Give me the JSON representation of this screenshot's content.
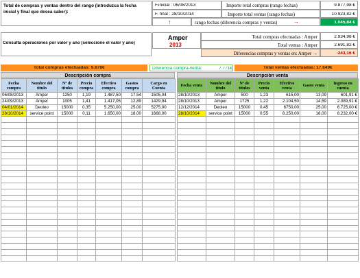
{
  "top": {
    "intro_text": "Total de compras y ventas dentro del rango (introduzca la fecha inicial y final que desea saber):",
    "f_inicial_label": "F.inicial : 06/08/2013",
    "f_final_label": "F. final : 28/10/2014",
    "import_compras_label": "Importe total compras  (rango fechas)",
    "import_compras_value": "9.877,98 €",
    "import_ventas_label": "Importe total ventas (rango fechas)",
    "import_ventas_value": "10.923,82 €",
    "rango_label": "rango fechas (diferencia compras y ventas)",
    "rango_arrow_up": "↑",
    "rango_arrow_right": "→",
    "rango_value": "1.045,84 €"
  },
  "consulta": {
    "label": "Consulta operaciones por valor y año (seleccione el valor y año)",
    "value_name": "Amper",
    "year": "2013",
    "total_compras_label": "Total compras efectuadas : Amper",
    "total_compras_value": "2.934,98 €",
    "total_ventas_label": "Total ventas : Amper",
    "total_ventas_value": "2.691,82 €",
    "diferencias_label": "Diferencias compras y ventas en:  Amper  →",
    "diferencias_value": "-243,16 €"
  },
  "summary": {
    "total_compras": "Total compras efectuadas: 9.878€",
    "diferencia": "Diferencia compra-venta:",
    "diferencia_value": "7.771€",
    "total_ventas": "Total ventas efectuadas: 17.649€"
  },
  "compra": {
    "title": "Descripción compra",
    "headers": [
      "Fecha compra",
      "Nombre del título",
      "Nº de títulos",
      "Precio compra",
      "Efectivo compra",
      "Gastos compra",
      "Cargo en Cuenta"
    ],
    "rows": [
      [
        "06/08/2013",
        "Amper",
        "1250",
        "1,19",
        "1.487,50",
        "17,54",
        "1505,04"
      ],
      [
        "24/09/2013",
        "Amper",
        "1005",
        "1,41",
        "1.417,05",
        "12,89",
        "1429,94"
      ],
      [
        "04/01/2014",
        "Deoleo",
        "15000",
        "0,35",
        "5.250,00",
        "25,00",
        "5275,00"
      ],
      [
        "28/10/2014",
        "service point",
        "15000",
        "0,11",
        "1.650,00",
        "18,00",
        "1668,00"
      ]
    ]
  },
  "venta": {
    "title": "Descripción venta",
    "headers": [
      "Fecha venta",
      "Nombre del título",
      "Nº de títulos",
      "Precio venta",
      "Efectivo venta",
      "Gasto venta",
      "Ingreso en cuenta"
    ],
    "rows": [
      [
        "28/10/2013",
        "Amper",
        "500",
        "1,23",
        "615,00",
        "13,09",
        "601,91 €"
      ],
      [
        "28/10/2013",
        "Amper",
        "1725",
        "1,22",
        "2.104,50",
        "14,59",
        "2.089,91 €"
      ],
      [
        "12/12/2014",
        "Deoleo",
        "15000",
        "0,45",
        "6750,00",
        "25,00",
        "6.725,00 €"
      ],
      [
        "28/10/2014",
        "service point",
        "15000",
        "0,55",
        "8.250,00",
        "18,00",
        "8.232,00 €"
      ]
    ]
  },
  "colors": {
    "accent_green": "#00a650",
    "orange": "#ff8f1f",
    "header_green": "#7fbf5a",
    "highlight_yellow": "#fff200",
    "red_text": "#c00000"
  }
}
